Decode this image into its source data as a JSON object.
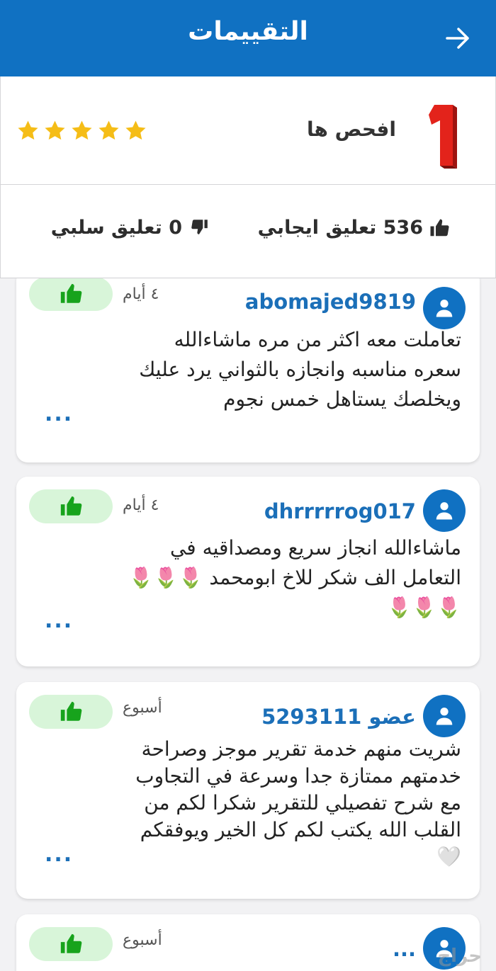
{
  "header": {
    "title": "التقييمات",
    "back_icon": "arrow-right-icon",
    "background": "#1071c2"
  },
  "seller": {
    "name": "افحص ها",
    "logo_text": "1",
    "rating_stars": 5,
    "star_color": "#f5bd17",
    "positive": "536 تعليق ايجابي",
    "negative": "0 تعليق سلبي"
  },
  "reviews": [
    {
      "username": "abomajed9819",
      "time": "٤ أيام",
      "text": "تعاملت معه اكثر من مره ماشاءالله\nسعره مناسبه وانجازه بالثواني يرد عليك\nويخلصك يستاهل خمس نجوم",
      "more": "..."
    },
    {
      "username": "dhrrrrrog017",
      "time": "٤ أيام",
      "text": "ماشاءالله انجاز سريع ومصداقيه في\nالتعامل الف شكر للاخ ابومحمد 🌷🌷🌷\n🌷🌷🌷",
      "more": "..."
    },
    {
      "username": "عضو 5293111",
      "time": "أسبوع",
      "text": "شريت منهم خدمة تقرير موجز وصراحة\nخدمتهم ممتازة جدا وسرعة في التجاوب\nمع شرح تفصيلي للتقرير  شكرا لكم من\nالقلب الله يكتب لكم كل الخير ويوفقكم\n🤍",
      "more": "..."
    },
    {
      "username": "...",
      "time": "أسبوع",
      "text": "",
      "more": ""
    }
  ],
  "watermark": "حراج"
}
